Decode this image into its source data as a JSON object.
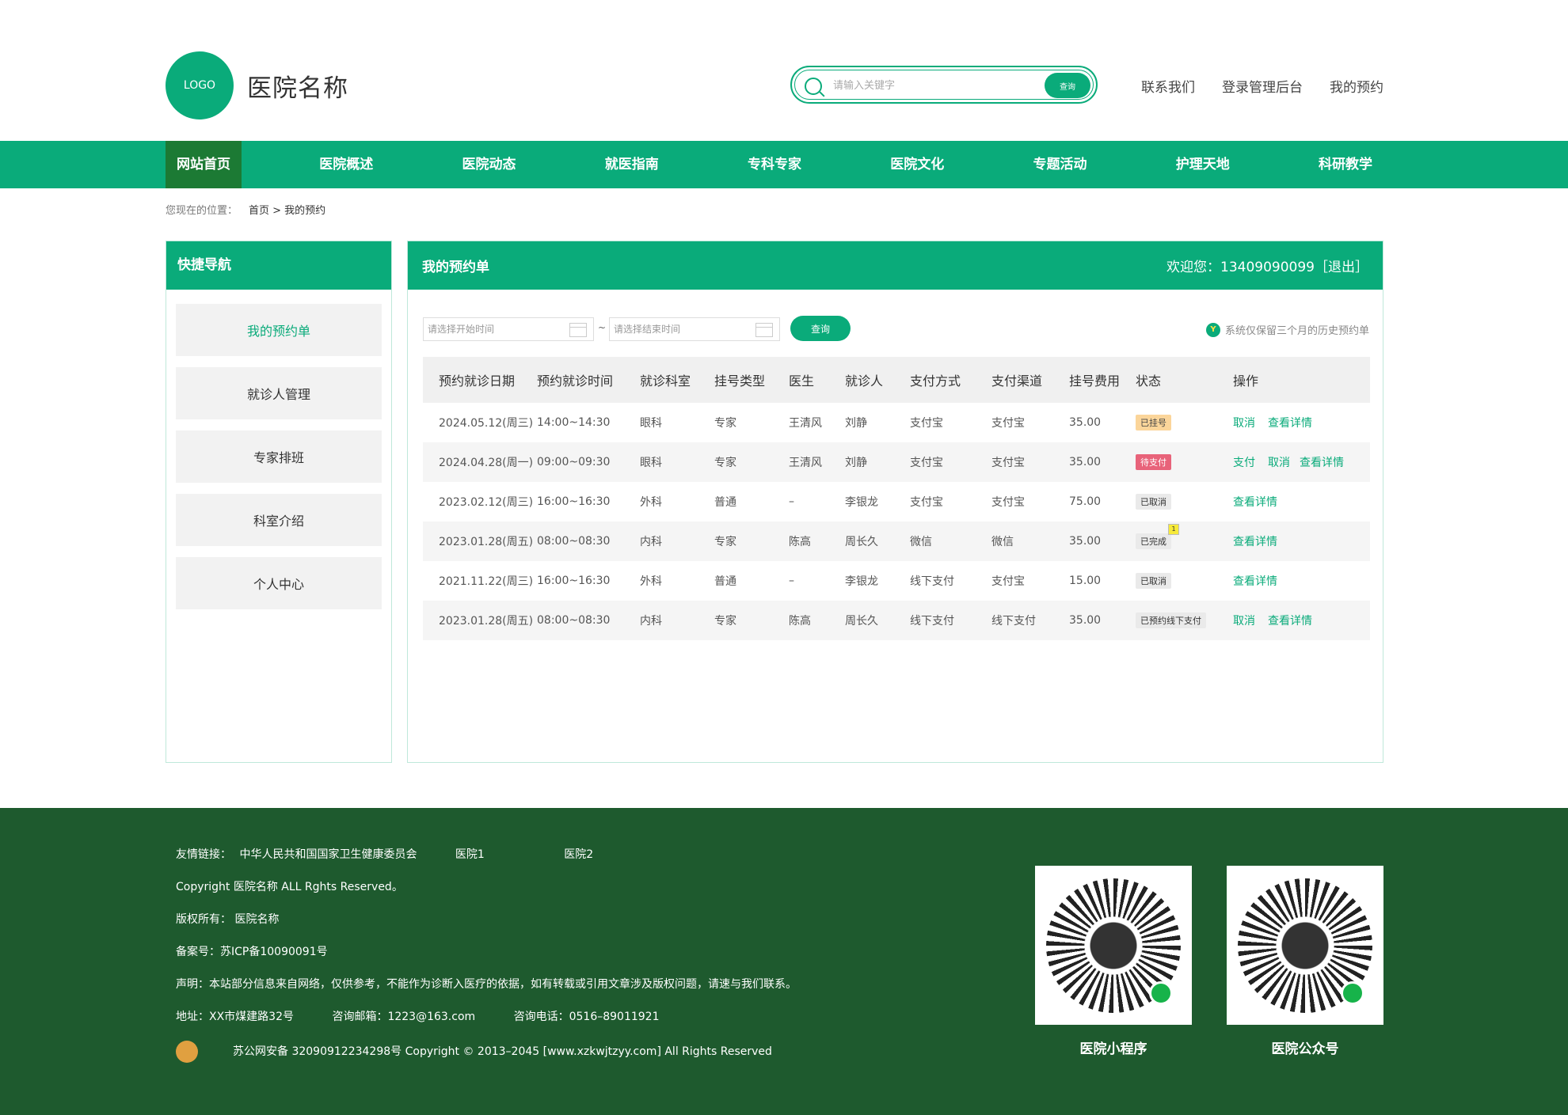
{
  "header": {
    "logo": "LOGO",
    "site_name": "医院名称",
    "search_placeholder": "请输入关键字",
    "search_button": "查询",
    "links": [
      "联系我们",
      "登录管理后台",
      "我的预约"
    ]
  },
  "nav": [
    "网站首页",
    "医院概述",
    "医院动态",
    "就医指南",
    "专科专家",
    "医院文化",
    "专题活动",
    "护理天地",
    "科研教学"
  ],
  "breadcrumb": {
    "label": "您现在的位置：",
    "path": "首页 > 我的预约"
  },
  "sidebar": {
    "title": "快捷导航",
    "items": [
      "我的预约单",
      "就诊人管理",
      "专家排班",
      "科室介绍",
      "个人中心"
    ]
  },
  "panel": {
    "title": "我的预约单",
    "welcome": "欢迎您：13409090099［退出］",
    "start_placeholder": "请选择开始时间",
    "end_placeholder": "请选择结束时间",
    "separator": "~",
    "query": "查询",
    "notice": "系统仅保留三个月的历史预约单",
    "notice_icon": "Y"
  },
  "table": {
    "headers": [
      "预约就诊日期",
      "预约就诊时间",
      "就诊科室",
      "挂号类型",
      "医生",
      "就诊人",
      "支付方式",
      "支付渠道",
      "挂号费用",
      "状态",
      "操作"
    ],
    "rows": [
      [
        "2024.05.12(周三)",
        "14:00~14:30",
        "眼科",
        "专家",
        "王清风",
        "刘静",
        "支付宝",
        "支付宝",
        "35.00",
        "已挂号",
        "取消",
        "查看详情"
      ],
      [
        "2024.04.28(周一)",
        "09:00~09:30",
        "眼科",
        "专家",
        "王清风",
        "刘静",
        "支付宝",
        "支付宝",
        "35.00",
        "待支付",
        "支付",
        "取消",
        "查看详情"
      ],
      [
        "2023.02.12(周三)",
        "16:00~16:30",
        "外科",
        "普通",
        "–",
        "李银龙",
        "支付宝",
        "支付宝",
        "75.00",
        "已取消",
        "查看详情"
      ],
      [
        "2023.01.28(周五)",
        "08:00~08:30",
        "内科",
        "专家",
        "陈高",
        "周长久",
        "微信",
        "微信",
        "35.00",
        "已完成",
        "查看详情"
      ],
      [
        "2021.11.22(周三)",
        "16:00~16:30",
        "外科",
        "普通",
        "–",
        "李银龙",
        "线下支付",
        "支付宝",
        "15.00",
        "已取消",
        "查看详情"
      ],
      [
        "2023.01.28(周五)",
        "08:00~08:30",
        "内科",
        "专家",
        "陈高",
        "周长久",
        "线下支付",
        "线下支付",
        "35.00",
        "已预约线下支付",
        "取消",
        "查看详情"
      ]
    ]
  },
  "footer": {
    "links_label": "友情链接：",
    "links": [
      "中华人民共和国国家卫生健康委员会",
      "医院1",
      "医院2"
    ],
    "copyright": "Copyright  医院名称 ALL Rghts Reserved。",
    "owner": "版权所有：  医院名称",
    "icp": "备案号：苏ICP备10090091号",
    "statement": "声明：本站部分信息来自网络，仅供参考，不能作为诊断入医疗的依据，如有转载或引用文章涉及版权问题，请速与我们联系。",
    "address": "地址：XX市煤建路32号",
    "email": "咨询邮箱：1223@163.com",
    "phone": "咨询电话：0516–89011921",
    "police": "苏公网安备   32090912234298号 Copyright © 2013–2045 [www.xzkwjtzyy.com] All Rights Reserved",
    "qr1": "医院小程序",
    "qr2": "医院公众号"
  }
}
